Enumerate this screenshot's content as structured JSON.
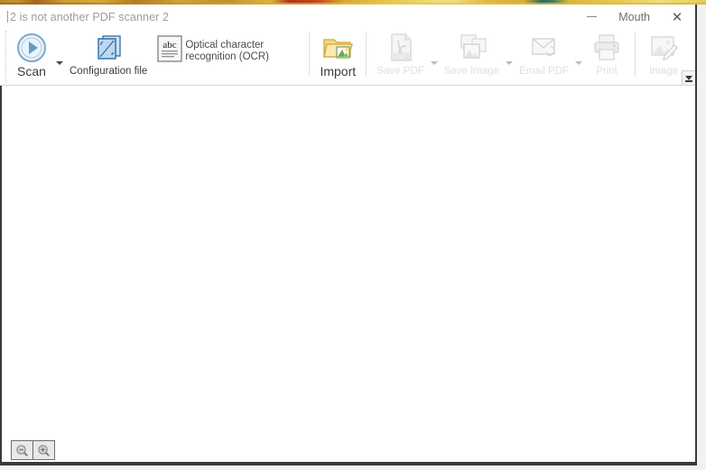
{
  "window": {
    "title": "2 is not another PDF scanner 2",
    "minimize_label": "minimize",
    "user_label": "Mouth",
    "close_label": "✕"
  },
  "toolbar": {
    "items": [
      {
        "id": "scan",
        "label": "Scan",
        "icon": "scan-play-icon",
        "enabled": true,
        "has_dropdown": true
      },
      {
        "id": "configuration-file",
        "label": "Configuration file",
        "icon": "configuration-file-icon",
        "enabled": true,
        "has_dropdown": false
      },
      {
        "id": "ocr",
        "label": "Optical character recognition (OCR)",
        "icon": "abc-ocr-icon",
        "enabled": true,
        "has_dropdown": false
      },
      {
        "id": "import",
        "label": "Import",
        "icon": "import-folder-icon",
        "enabled": true,
        "has_dropdown": false
      },
      {
        "id": "save-pdf",
        "label": "Save PDF",
        "icon": "pdf-file-icon",
        "enabled": false,
        "has_dropdown": true
      },
      {
        "id": "save-image",
        "label": "Save Image",
        "icon": "images-stack-icon",
        "enabled": false,
        "has_dropdown": true
      },
      {
        "id": "email-pdf",
        "label": "Email PDF",
        "icon": "envelope-attachment-icon",
        "enabled": false,
        "has_dropdown": true
      },
      {
        "id": "print",
        "label": "Print",
        "icon": "printer-icon",
        "enabled": false,
        "has_dropdown": false
      },
      {
        "id": "image",
        "label": "Image",
        "icon": "image-edit-icon",
        "enabled": false,
        "has_dropdown": false
      }
    ],
    "overflow_label": "more toolbar commands"
  },
  "statusbar": {
    "zoom_out_label": "Zoom out",
    "zoom_in_label": "Zoom in"
  },
  "colors": {
    "accent_blue": "#3f7fbf",
    "folder_yellow": "#f0c35c",
    "window_border": "#3a3a3a",
    "title_text": "#9c9c9c",
    "disabled_text": "#b4b4b4"
  }
}
